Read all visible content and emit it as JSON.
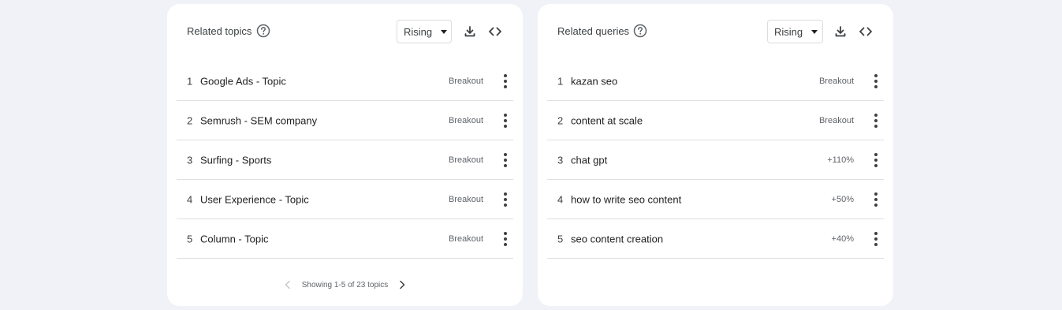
{
  "topics": {
    "title": "Related topics",
    "select_value": "Rising",
    "rows": [
      {
        "rank": "1",
        "label": "Google Ads - Topic",
        "value": "Breakout"
      },
      {
        "rank": "2",
        "label": "Semrush - SEM company",
        "value": "Breakout"
      },
      {
        "rank": "3",
        "label": "Surfing - Sports",
        "value": "Breakout"
      },
      {
        "rank": "4",
        "label": "User Experience - Topic",
        "value": "Breakout"
      },
      {
        "rank": "5",
        "label": "Column - Topic",
        "value": "Breakout"
      }
    ],
    "pagination": "Showing 1-5 of 23 topics"
  },
  "queries": {
    "title": "Related queries",
    "select_value": "Rising",
    "rows": [
      {
        "rank": "1",
        "label": "kazan seo",
        "value": "Breakout"
      },
      {
        "rank": "2",
        "label": "content at scale",
        "value": "Breakout"
      },
      {
        "rank": "3",
        "label": "chat gpt",
        "value": "+110%"
      },
      {
        "rank": "4",
        "label": "how to write seo content",
        "value": "+50%"
      },
      {
        "rank": "5",
        "label": "seo content creation",
        "value": "+40%"
      }
    ]
  },
  "icons": {
    "help": "help-circle-icon",
    "download": "download-icon",
    "embed": "code-embed-icon",
    "more": "more-vert-icon",
    "prev": "chevron-left-icon",
    "next": "chevron-right-icon"
  },
  "colors": {
    "background": "#f0f2f7",
    "card": "#ffffff",
    "text": "#202124",
    "secondary_text": "#5f6368",
    "divider": "#e0e0e0"
  }
}
